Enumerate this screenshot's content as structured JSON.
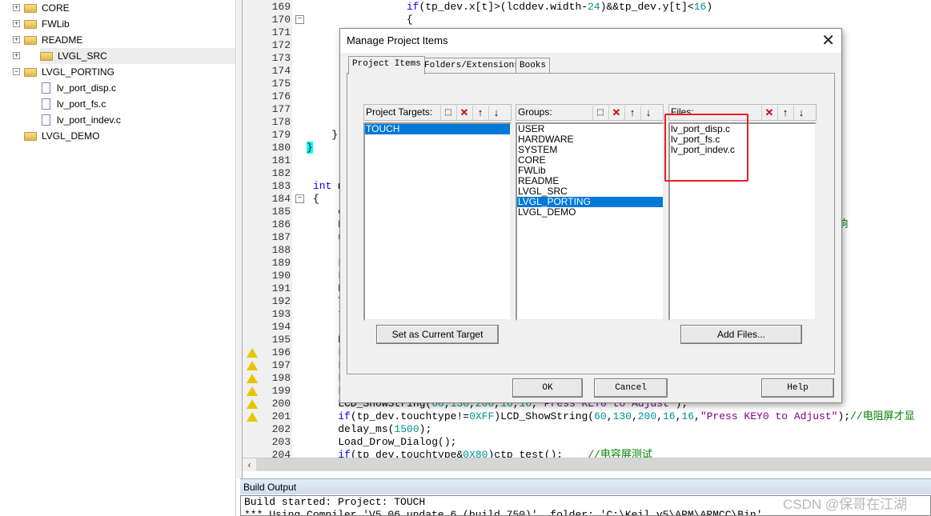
{
  "tree": {
    "items": [
      {
        "label": "CORE",
        "type": "folder",
        "expanded": false
      },
      {
        "label": "FWLib",
        "type": "folder",
        "expanded": false
      },
      {
        "label": "README",
        "type": "folder",
        "expanded": false
      },
      {
        "label": "LVGL_SRC",
        "type": "folder",
        "expanded": false,
        "selected": true
      },
      {
        "label": "LVGL_PORTING",
        "type": "folder",
        "expanded": true
      },
      {
        "label": "lv_port_disp.c",
        "type": "file"
      },
      {
        "label": "lv_port_fs.c",
        "type": "file"
      },
      {
        "label": "lv_port_indev.c",
        "type": "file"
      },
      {
        "label": "LVGL_DEMO",
        "type": "folder",
        "expanded": false
      }
    ]
  },
  "editor": {
    "lines": [
      {
        "n": "169",
        "seg": [
          [
            "                ",
            ""
          ],
          [
            "if",
            "kw"
          ],
          [
            "(tp_dev.x[t]>(lcddev.width-",
            ""
          ],
          [
            "24",
            "num"
          ],
          [
            ")&&tp_dev.y[t]<",
            ""
          ],
          [
            "16",
            "num"
          ],
          [
            ")",
            ""
          ]
        ]
      },
      {
        "n": "170",
        "fold": "-",
        "seg": [
          [
            "                {",
            ""
          ]
        ]
      },
      {
        "n": "171",
        "seg": []
      },
      {
        "n": "172",
        "seg": []
      },
      {
        "n": "173",
        "seg": []
      },
      {
        "n": "174",
        "seg": []
      },
      {
        "n": "175",
        "seg": []
      },
      {
        "n": "176",
        "seg": []
      },
      {
        "n": "177",
        "seg": []
      },
      {
        "n": "178",
        "seg": []
      },
      {
        "n": "179",
        "seg": [
          [
            "    }",
            ""
          ]
        ]
      },
      {
        "n": "180",
        "seg": [
          [
            "}",
            "hl"
          ]
        ]
      },
      {
        "n": "181",
        "seg": []
      },
      {
        "n": "182",
        "seg": []
      },
      {
        "n": "183",
        "seg": [
          [
            "int",
            "kw"
          ],
          [
            " m",
            ""
          ]
        ]
      },
      {
        "n": "184",
        "fold": "-",
        "seg": [
          [
            "{",
            ""
          ]
        ]
      },
      {
        "n": "185",
        "seg": [
          [
            "    d",
            ""
          ]
        ]
      },
      {
        "n": "186",
        "seg": [
          [
            "    N",
            ""
          ],
          [
            "                                                                    占优先级，2位响",
            "cm"
          ]
        ]
      },
      {
        "n": "187",
        "seg": [
          [
            "    u",
            ""
          ]
        ]
      },
      {
        "n": "188",
        "seg": []
      },
      {
        "n": "189",
        "seg": [
          [
            "    L",
            ""
          ]
        ]
      },
      {
        "n": "190",
        "seg": [
          [
            "    L",
            ""
          ]
        ]
      },
      {
        "n": "191",
        "seg": [
          [
            "    K",
            ""
          ]
        ]
      },
      {
        "n": "192",
        "seg": [
          [
            "    T",
            ""
          ]
        ]
      },
      {
        "n": "193",
        "seg": [
          [
            "    t",
            ""
          ]
        ]
      },
      {
        "n": "194",
        "seg": []
      },
      {
        "n": "195",
        "seg": [
          [
            "    P",
            ""
          ]
        ]
      },
      {
        "n": "196",
        "warn": true,
        "seg": [
          [
            "    L",
            ""
          ]
        ]
      },
      {
        "n": "197",
        "warn": true,
        "seg": [
          [
            "    L",
            ""
          ]
        ]
      },
      {
        "n": "198",
        "warn": true,
        "seg": [
          [
            "    L",
            ""
          ]
        ]
      },
      {
        "n": "199",
        "warn": true,
        "seg": [
          [
            "    L",
            ""
          ]
        ]
      },
      {
        "n": "200",
        "warn": true,
        "seg": [
          [
            "    LCD_ShowString(",
            ""
          ],
          [
            "60",
            "num"
          ],
          [
            ",",
            ""
          ],
          [
            "130",
            "num"
          ],
          [
            ",",
            ""
          ],
          [
            "200",
            "num"
          ],
          [
            ",",
            ""
          ],
          [
            "16",
            "num"
          ],
          [
            ",",
            ""
          ],
          [
            "16",
            "num"
          ],
          [
            ",",
            ""
          ],
          [
            "\"Press KEY0 to Adjust\"",
            "str"
          ],
          [
            ");",
            ""
          ]
        ]
      },
      {
        "n": "201",
        "warn": true,
        "seg": [
          [
            "    ",
            ""
          ],
          [
            "if",
            "kw"
          ],
          [
            "(tp_dev.touchtype!=",
            ""
          ],
          [
            "0XFF",
            "num"
          ],
          [
            ")LCD_ShowString(",
            ""
          ],
          [
            "60",
            "num"
          ],
          [
            ",",
            ""
          ],
          [
            "130",
            "num"
          ],
          [
            ",",
            ""
          ],
          [
            "200",
            "num"
          ],
          [
            ",",
            ""
          ],
          [
            "16",
            "num"
          ],
          [
            ",",
            ""
          ],
          [
            "16",
            "num"
          ],
          [
            ",",
            ""
          ],
          [
            "\"Press KEY0 to Adjust\"",
            "str"
          ],
          [
            ");",
            ""
          ],
          [
            "//电阻屏才显",
            "cm"
          ]
        ]
      },
      {
        "n": "202",
        "seg": [
          [
            "    delay_ms(",
            ""
          ],
          [
            "1500",
            "num"
          ],
          [
            ");",
            ""
          ]
        ]
      },
      {
        "n": "203",
        "seg": [
          [
            "    Load_Drow_Dialog();",
            ""
          ]
        ]
      },
      {
        "n": "204",
        "seg": [
          [
            "    ",
            ""
          ],
          [
            "if",
            "kw"
          ],
          [
            "(tp_dev.touchtype&",
            ""
          ],
          [
            "0X80",
            "num"
          ],
          [
            ")ctp_test();    ",
            ""
          ],
          [
            "//电容屏测试",
            "cm"
          ]
        ]
      }
    ]
  },
  "build_output": {
    "title": "Build Output",
    "lines": [
      "Build started: Project: TOUCH",
      "*** Using Compiler 'V5.06 update 6 (build 750)', folder: 'C:\\Keil_v5\\ARM\\ARMCC\\Bin'"
    ]
  },
  "watermark": "CSDN @保哥在江湖",
  "dialog": {
    "title": "Manage Project Items",
    "tabs": [
      "Project Items",
      "Folders/Extensions",
      "Books"
    ],
    "active_tab": 0,
    "targets": {
      "label": "Project Targets:",
      "items": [
        "TOUCH"
      ],
      "selected": 0
    },
    "groups": {
      "label": "Groups:",
      "items": [
        "USER",
        "HARDWARE",
        "SYSTEM",
        "CORE",
        "FWLib",
        "README",
        "LVGL_SRC",
        "LVGL_PORTING",
        "LVGL_DEMO"
      ],
      "selected": 7
    },
    "files": {
      "label": "Files:",
      "items": [
        "lv_port_disp.c",
        "lv_port_fs.c",
        "lv_port_indev.c"
      ]
    },
    "set_target_label": "Set as Current Target",
    "add_files_label": "Add Files...",
    "ok_label": "OK",
    "cancel_label": "Cancel",
    "help_label": "Help",
    "highlight_color": "#ee1c1c"
  }
}
